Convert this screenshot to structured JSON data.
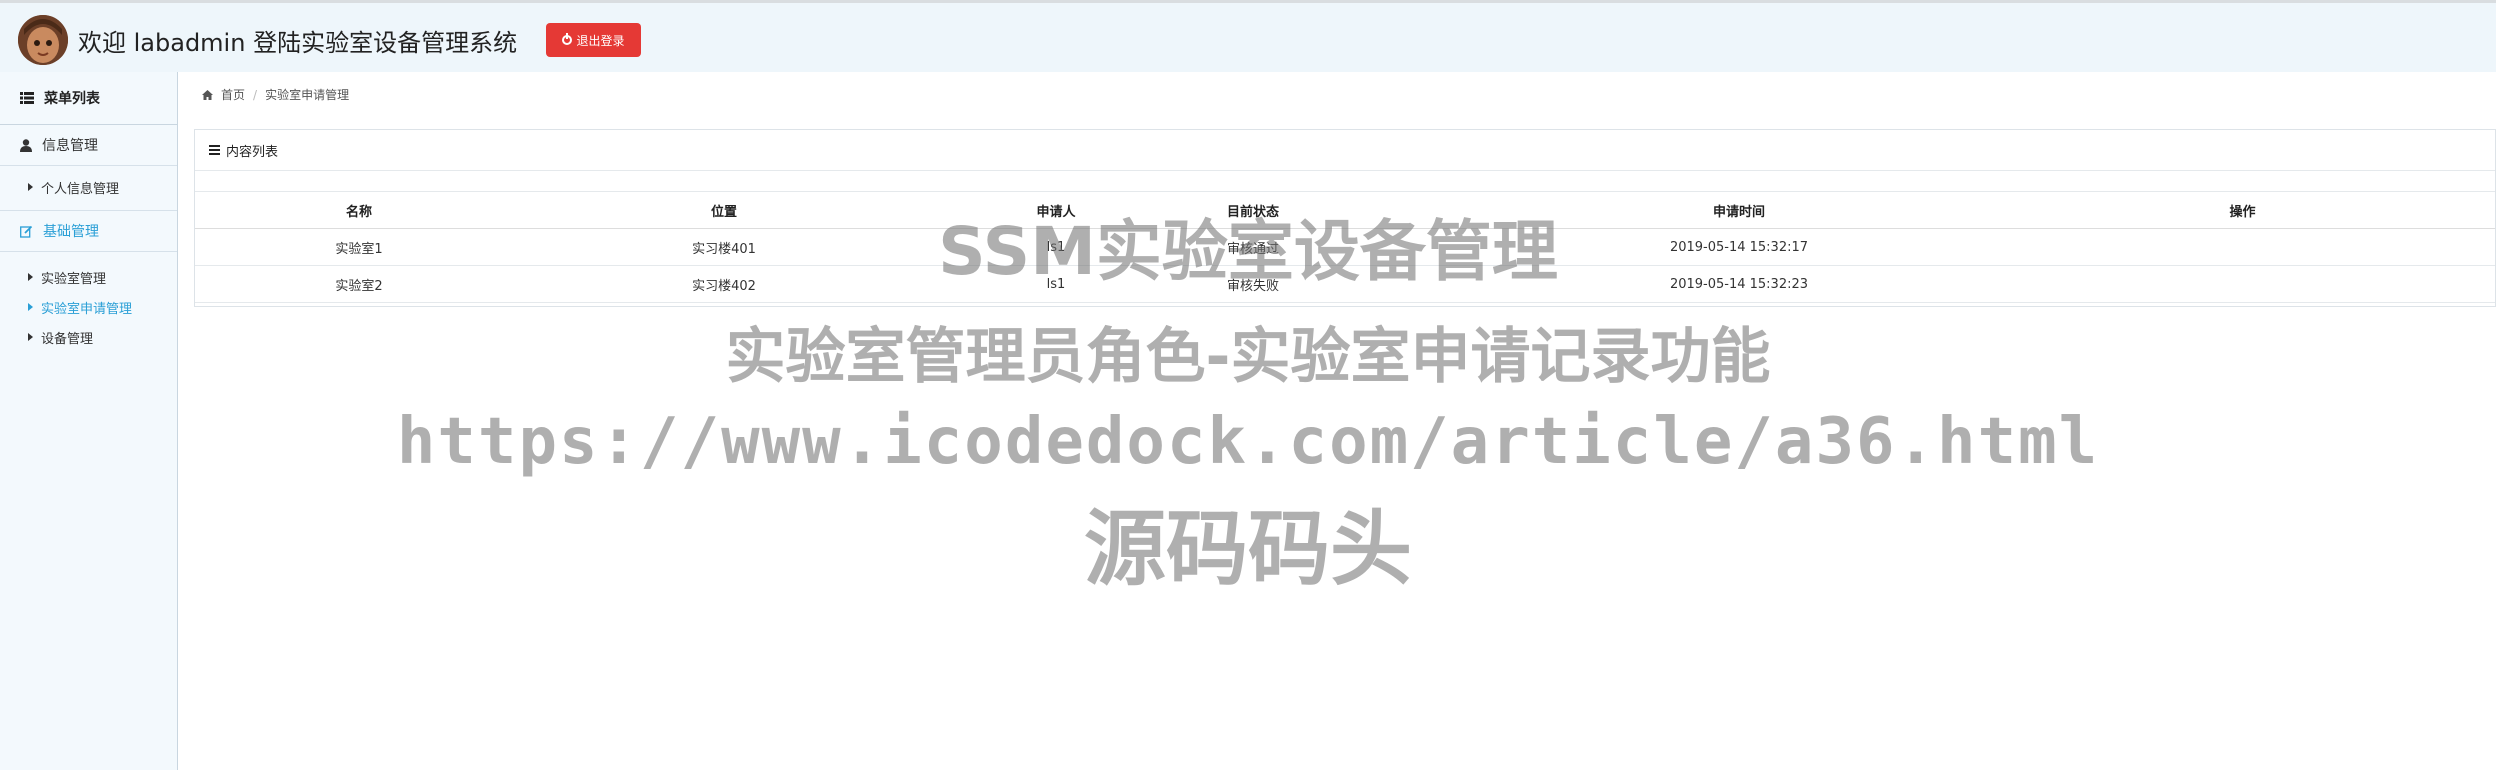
{
  "header": {
    "title": "欢迎 labadmin 登陆实验室设备管理系统",
    "logout_label": "退出登录",
    "logout_color": "#e53935"
  },
  "sidebar": {
    "heading": "菜单列表",
    "groups": [
      {
        "label": "信息管理",
        "icon": "user-icon",
        "items": [
          {
            "label": "个人信息管理"
          }
        ]
      },
      {
        "label": "基础管理",
        "icon": "edit-icon",
        "active": true,
        "items": [
          {
            "label": "实验室管理"
          },
          {
            "label": "实验室申请管理",
            "active": true
          },
          {
            "label": "设备管理"
          }
        ]
      }
    ],
    "accent_color": "#2a9fd6"
  },
  "breadcrumb": {
    "home": "首页",
    "current": "实验室申请管理",
    "home_icon": "home-icon"
  },
  "panel": {
    "title": "内容列表",
    "columns": [
      "名称",
      "位置",
      "申请人",
      "目前状态",
      "申请时间",
      "操作"
    ],
    "rows": [
      [
        "实验室1",
        "实习楼401",
        "ls1",
        "审核通过",
        "2019-05-14 15:32:17",
        ""
      ],
      [
        "实验室2",
        "实习楼402",
        "ls1",
        "审核失败",
        "2019-05-14 15:32:23",
        ""
      ]
    ]
  },
  "watermark": {
    "line1": "SSM实验室设备管理",
    "line2": "实验室管理员角色-实验室申请记录功能",
    "line3": "https://www.icodedock.com/article/a36.html",
    "line4": "源码码头"
  }
}
